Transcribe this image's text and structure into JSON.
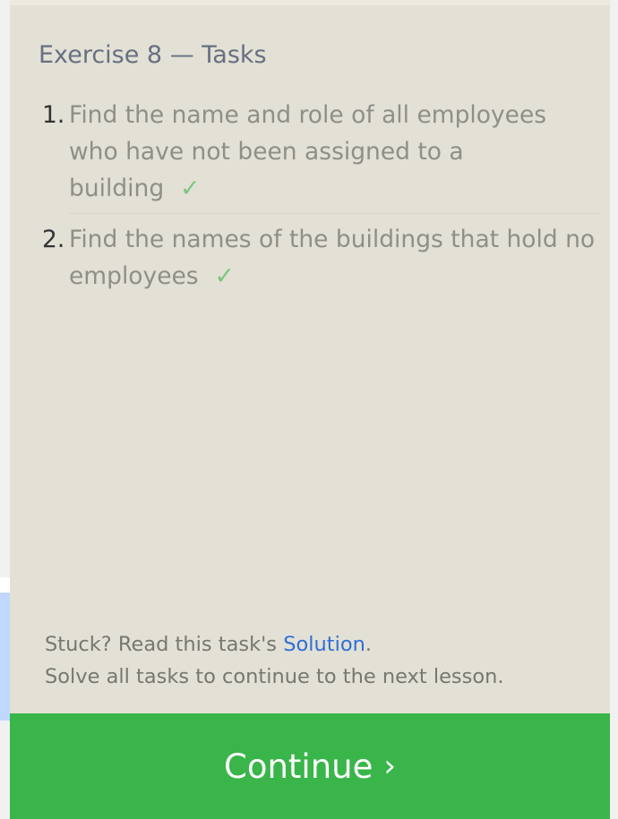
{
  "panel": {
    "title": "Exercise 8 — Tasks"
  },
  "tasks": [
    {
      "number": "1.",
      "text": "Find the name and role of all employees who have not been assigned to a building",
      "completed": true,
      "check_symbol": "✓"
    },
    {
      "number": "2.",
      "text": "Find the names of the buildings that hold no employees",
      "completed": true,
      "check_symbol": "✓"
    }
  ],
  "footer": {
    "stuck_prefix": "Stuck? Read this task's ",
    "solution_link": "Solution",
    "stuck_suffix": ".",
    "instruction": "Solve all tasks to continue to the next lesson."
  },
  "continue_button": {
    "label": "Continue",
    "chevron": "›"
  },
  "colors": {
    "panel_bg": "#e3e0d6",
    "title": "#667080",
    "task_text": "#8f8f88",
    "check": "#7cc67e",
    "link": "#2f6fd6",
    "button_bg": "#3ab54a"
  }
}
